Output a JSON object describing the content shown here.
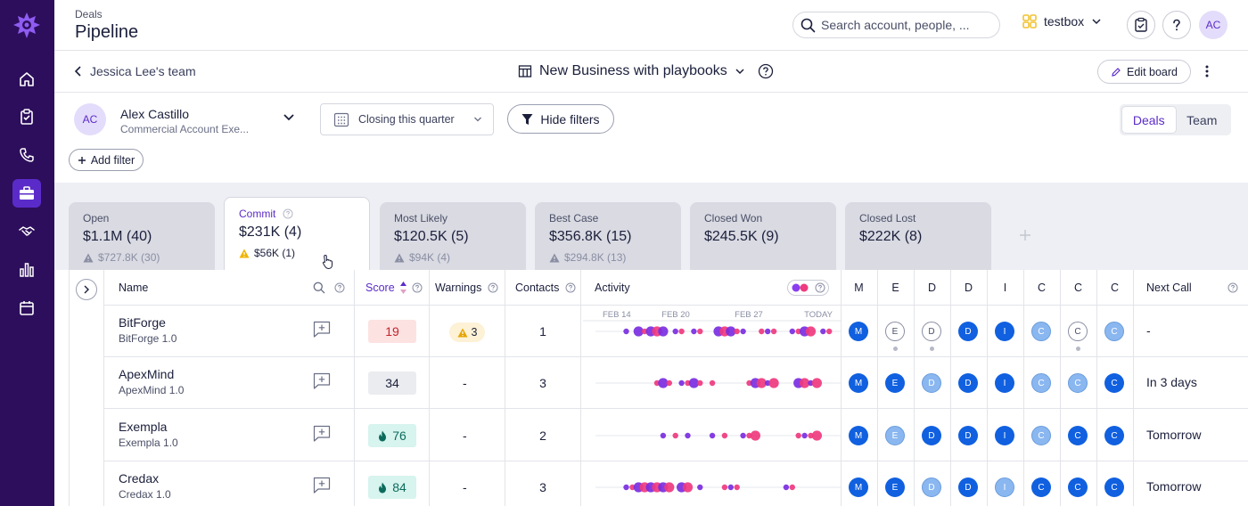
{
  "colors": {
    "sidebar": "#2d0e5c",
    "accent": "#5b2bc9",
    "dot_purple": "#7a2ee0",
    "dot_pink": "#ef3a7e",
    "mono_blue": "#1060e0"
  },
  "sidebar": {
    "items": [
      {
        "icon": "home-icon"
      },
      {
        "icon": "clipboard-icon"
      },
      {
        "icon": "phone-icon"
      },
      {
        "icon": "briefcase-icon",
        "active": true
      },
      {
        "icon": "handshake-icon"
      },
      {
        "icon": "bar-chart-icon"
      },
      {
        "icon": "calendar-icon"
      }
    ]
  },
  "header": {
    "section": "Deals",
    "title": "Pipeline",
    "search_placeholder": "Search account, people, ...",
    "workspace": "testbox",
    "avatar": "AC"
  },
  "board": {
    "back_label": "Jessica Lee's team",
    "name": "New Business with playbooks",
    "edit_label": "Edit board"
  },
  "filters": {
    "owner_initials": "AC",
    "owner_name": "Alex Castillo",
    "owner_role": "Commercial Account Exe...",
    "period": "Closing this quarter",
    "hide_label": "Hide filters",
    "add_label": "Add filter",
    "view_deals": "Deals",
    "view_team": "Team"
  },
  "stages": [
    {
      "name": "Open",
      "value": "$1.1M (40)",
      "warn": "$727.8K (30)"
    },
    {
      "name": "Commit",
      "value": "$231K (4)",
      "warn": "$56K (1)",
      "active": true
    },
    {
      "name": "Most Likely",
      "value": "$120.5K (5)",
      "warn": "$94K (4)"
    },
    {
      "name": "Best Case",
      "value": "$356.8K (15)",
      "warn": "$294.8K (13)"
    },
    {
      "name": "Closed Won",
      "value": "$245.5K (9)",
      "warn": ""
    },
    {
      "name": "Closed Lost",
      "value": "$222K (8)",
      "warn": ""
    }
  ],
  "columns": {
    "name": "Name",
    "score": "Score",
    "warnings": "Warnings",
    "contacts": "Contacts",
    "activity": "Activity",
    "meddic": [
      "M",
      "E",
      "D",
      "D",
      "I",
      "C",
      "C",
      "C"
    ],
    "next_call": "Next Call"
  },
  "timeline": [
    "FEB 14",
    "FEB 20",
    "FEB 27",
    "TODAY"
  ],
  "deals": [
    {
      "name": "BitForge",
      "sub": "BitForge 1.0",
      "score": "19",
      "score_style": "red",
      "score_icon": false,
      "warnings": "3",
      "contacts": "1",
      "next_call": "-",
      "meddic": [
        {
          "t": "M",
          "s": "solid"
        },
        {
          "t": "E",
          "s": "outline",
          "dot": true
        },
        {
          "t": "D",
          "s": "outline",
          "dot": true
        },
        {
          "t": "D",
          "s": "solid"
        },
        {
          "t": "I",
          "s": "solid"
        },
        {
          "t": "C",
          "s": "light"
        },
        {
          "t": "C",
          "s": "outline",
          "dot": true
        },
        {
          "t": "C",
          "s": "light"
        }
      ],
      "activity": [
        [
          5,
          0,
          0
        ],
        [
          7,
          0,
          1
        ],
        [
          8,
          1,
          0
        ],
        [
          9,
          0,
          1
        ],
        [
          10,
          1,
          1
        ],
        [
          11,
          0,
          1
        ],
        [
          13,
          0,
          0
        ],
        [
          14,
          1,
          0
        ],
        [
          16,
          0,
          0
        ],
        [
          17,
          1,
          0
        ],
        [
          20,
          0,
          1
        ],
        [
          21,
          1,
          1
        ],
        [
          22,
          0,
          1
        ],
        [
          23,
          1,
          0
        ],
        [
          24,
          0,
          0
        ],
        [
          27,
          1,
          0
        ],
        [
          28,
          0,
          0
        ],
        [
          29,
          1,
          0
        ],
        [
          32,
          0,
          0
        ],
        [
          33,
          1,
          0
        ],
        [
          34,
          0,
          1
        ],
        [
          35,
          1,
          1
        ],
        [
          37,
          0,
          0
        ],
        [
          38,
          1,
          0
        ]
      ]
    },
    {
      "name": "ApexMind",
      "sub": "ApexMind 1.0",
      "score": "34",
      "score_style": "gray",
      "score_icon": false,
      "warnings": "-",
      "contacts": "3",
      "next_call": "In 3 days",
      "meddic": [
        {
          "t": "M",
          "s": "solid"
        },
        {
          "t": "E",
          "s": "solid"
        },
        {
          "t": "D",
          "s": "light"
        },
        {
          "t": "D",
          "s": "solid"
        },
        {
          "t": "I",
          "s": "solid"
        },
        {
          "t": "C",
          "s": "light"
        },
        {
          "t": "C",
          "s": "light"
        },
        {
          "t": "C",
          "s": "solid"
        }
      ],
      "activity": [
        [
          10,
          1,
          0
        ],
        [
          11,
          0,
          1
        ],
        [
          12,
          1,
          0
        ],
        [
          14,
          0,
          0
        ],
        [
          15,
          1,
          0
        ],
        [
          16,
          0,
          1
        ],
        [
          17,
          1,
          0
        ],
        [
          19,
          1,
          0
        ],
        [
          25,
          1,
          0
        ],
        [
          26,
          0,
          1
        ],
        [
          27,
          1,
          1
        ],
        [
          28,
          0,
          0
        ],
        [
          29,
          1,
          1
        ],
        [
          33,
          0,
          1
        ],
        [
          34,
          1,
          1
        ],
        [
          35,
          0,
          0
        ],
        [
          36,
          1,
          1
        ]
      ]
    },
    {
      "name": "Exempla",
      "sub": "Exempla 1.0",
      "score": "76",
      "score_style": "green",
      "score_icon": true,
      "warnings": "-",
      "contacts": "2",
      "next_call": "Tomorrow",
      "meddic": [
        {
          "t": "M",
          "s": "solid"
        },
        {
          "t": "E",
          "s": "light"
        },
        {
          "t": "D",
          "s": "solid"
        },
        {
          "t": "D",
          "s": "solid"
        },
        {
          "t": "I",
          "s": "solid"
        },
        {
          "t": "C",
          "s": "light"
        },
        {
          "t": "C",
          "s": "solid"
        },
        {
          "t": "C",
          "s": "solid"
        }
      ],
      "activity": [
        [
          11,
          0,
          0
        ],
        [
          13,
          1,
          0
        ],
        [
          15,
          0,
          0
        ],
        [
          19,
          0,
          0
        ],
        [
          21,
          1,
          0
        ],
        [
          24,
          0,
          0
        ],
        [
          25,
          1,
          0
        ],
        [
          26,
          1,
          1
        ],
        [
          33,
          1,
          0
        ],
        [
          34,
          0,
          0
        ],
        [
          35,
          1,
          0
        ],
        [
          36,
          1,
          1
        ]
      ]
    },
    {
      "name": "Credax",
      "sub": "Credax 1.0",
      "score": "84",
      "score_style": "green",
      "score_icon": true,
      "warnings": "-",
      "contacts": "3",
      "next_call": "Tomorrow",
      "meddic": [
        {
          "t": "M",
          "s": "solid"
        },
        {
          "t": "E",
          "s": "solid"
        },
        {
          "t": "D",
          "s": "light"
        },
        {
          "t": "D",
          "s": "solid"
        },
        {
          "t": "I",
          "s": "light"
        },
        {
          "t": "C",
          "s": "solid"
        },
        {
          "t": "C",
          "s": "solid"
        },
        {
          "t": "C",
          "s": "solid"
        }
      ],
      "activity": [
        [
          5,
          0,
          0
        ],
        [
          6,
          1,
          0
        ],
        [
          7,
          0,
          1
        ],
        [
          8,
          1,
          1
        ],
        [
          9,
          0,
          1
        ],
        [
          10,
          1,
          1
        ],
        [
          11,
          0,
          1
        ],
        [
          12,
          1,
          1
        ],
        [
          14,
          0,
          1
        ],
        [
          15,
          1,
          1
        ],
        [
          17,
          0,
          0
        ],
        [
          21,
          1,
          0
        ],
        [
          22,
          0,
          0
        ],
        [
          23,
          1,
          0
        ],
        [
          31,
          0,
          0
        ],
        [
          32,
          1,
          0
        ]
      ]
    }
  ]
}
